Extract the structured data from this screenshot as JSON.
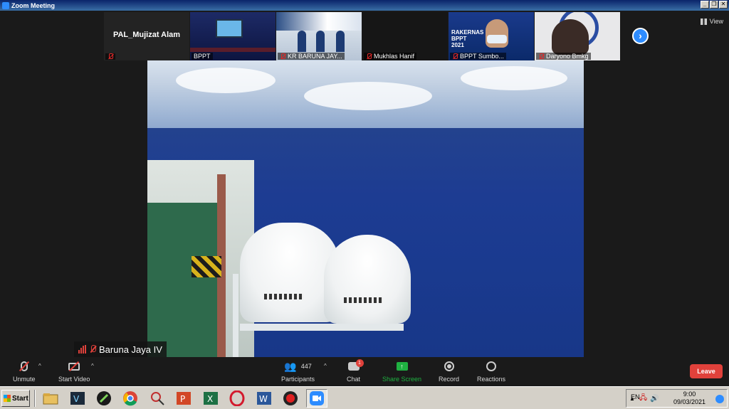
{
  "window": {
    "title": "Zoom Meeting",
    "minimize": "_",
    "restore": "❐",
    "close": "✕"
  },
  "gallery": {
    "tiles": [
      {
        "name": "PAL_Mujizat Alam",
        "caption": ""
      },
      {
        "name": "BPPT"
      },
      {
        "name": "KR BARUNA JAY..."
      },
      {
        "name": "Mukhlas Hanif"
      },
      {
        "name": "BPPT Sumbo...",
        "poster": "RAKERNAS BPPT 2021"
      },
      {
        "name": "Daryono Bmkg"
      }
    ],
    "next_arrow": "›",
    "view_label": "View"
  },
  "speaker": {
    "name": "Baruna Jaya IV"
  },
  "toolbar": {
    "unmute": "Unmute",
    "start_video": "Start Video",
    "participants": "Participants",
    "participants_count": "447",
    "chat": "Chat",
    "chat_badge": "1",
    "share_screen": "Share Screen",
    "record": "Record",
    "reactions": "Reactions",
    "leave": "Leave",
    "caret": "^"
  },
  "taskbar": {
    "start": "Start",
    "apps": [
      "file-explorer",
      "vlc",
      "chrome-like",
      "chrome",
      "search",
      "powerpoint",
      "excel",
      "opera",
      "word",
      "recorder",
      "zoom"
    ],
    "language": "EN",
    "time": "9:00",
    "date": "09/03/2021"
  },
  "colors": {
    "accent": "#2d8cff",
    "leave": "#e0413b",
    "share": "#1fb141"
  }
}
